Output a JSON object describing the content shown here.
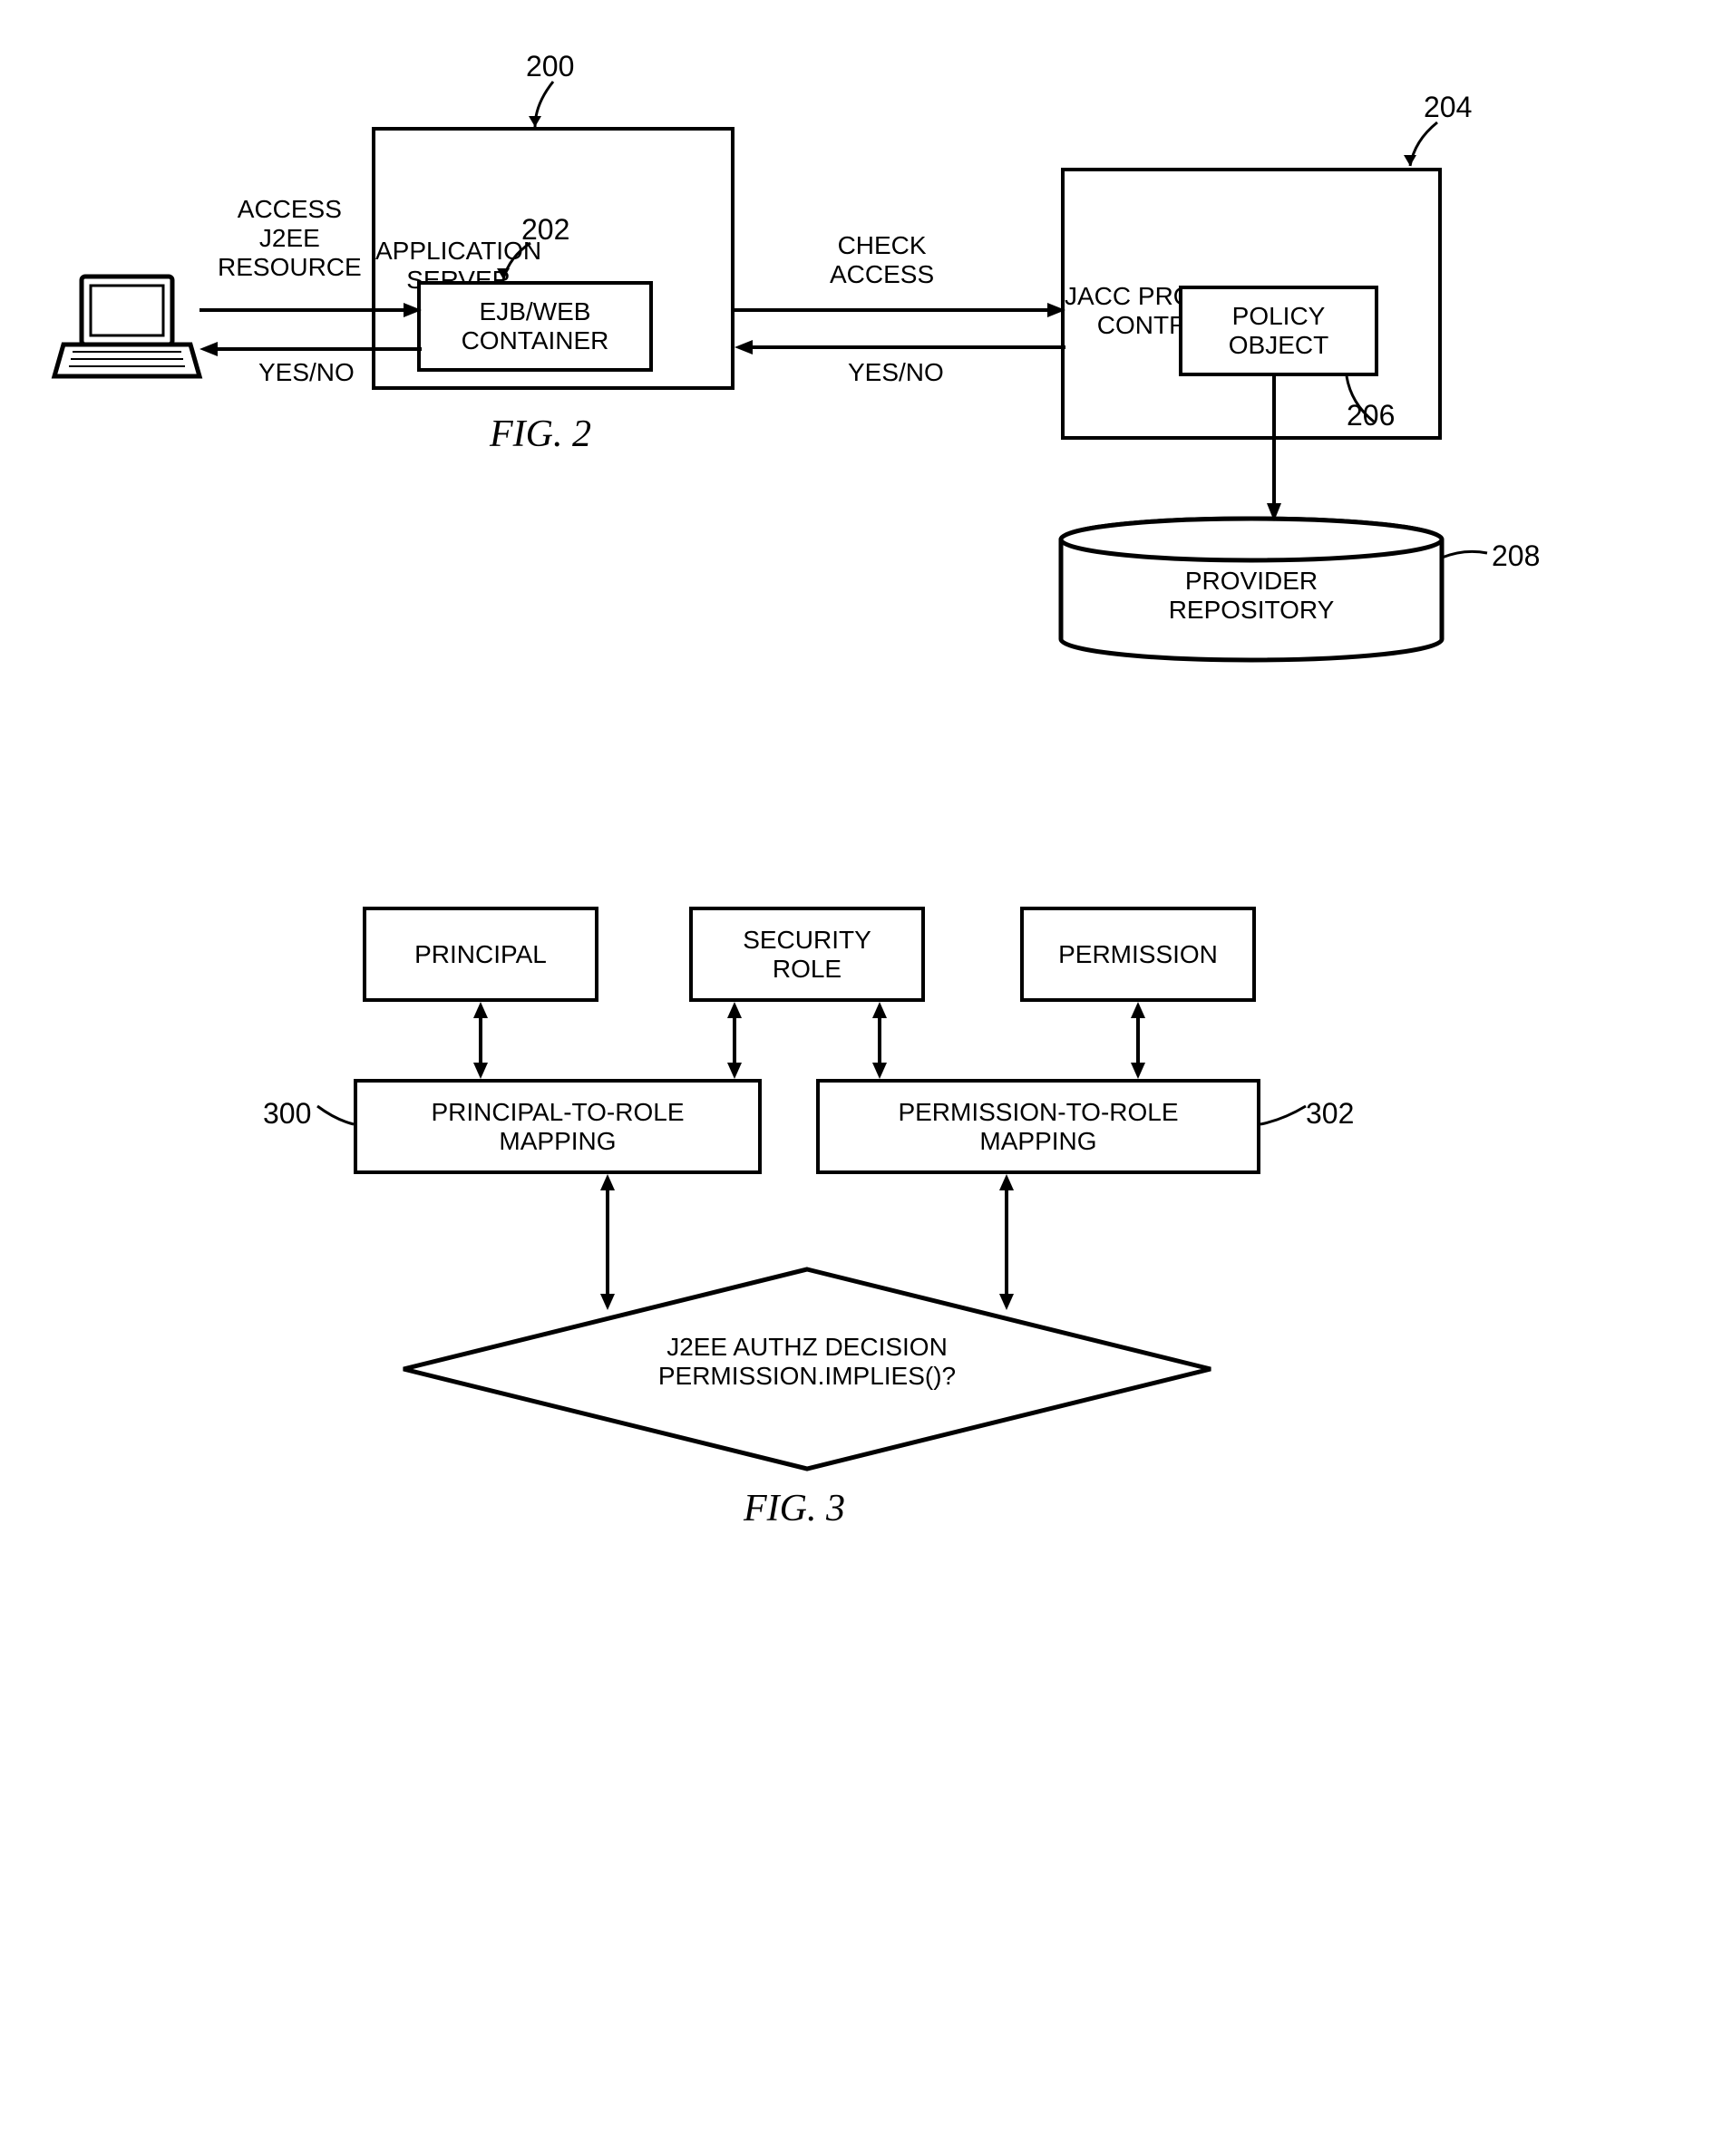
{
  "fig2": {
    "caption": "FIG. 2",
    "refs": {
      "appServer": "200",
      "container": "202",
      "jacc": "204",
      "policy": "206",
      "repo": "208"
    },
    "boxes": {
      "appServer": "APPLICATION\nSERVER",
      "container": "EJB/WEB\nCONTAINER",
      "jacc": "JACC PROVIDER\nCONTRACT",
      "policy": "POLICY\nOBJECT",
      "repo": "PROVIDER\nREPOSITORY"
    },
    "labels": {
      "accessResource": "ACCESS\nJ2EE\nRESOURCE",
      "yesNoLeft": "YES/NO",
      "checkAccess": "CHECK\nACCESS",
      "yesNoRight": "YES/NO"
    }
  },
  "fig3": {
    "caption": "FIG. 3",
    "refs": {
      "p2r": "300",
      "perm2r": "302"
    },
    "boxes": {
      "principal": "PRINCIPAL",
      "securityRole": "SECURITY\nROLE",
      "permission": "PERMISSION",
      "p2rMapping": "PRINCIPAL-TO-ROLE\nMAPPING",
      "perm2rMapping": "PERMISSION-TO-ROLE\nMAPPING",
      "decision": "J2EE AUTHZ DECISION\nPERMISSION.IMPLIES()?"
    }
  }
}
